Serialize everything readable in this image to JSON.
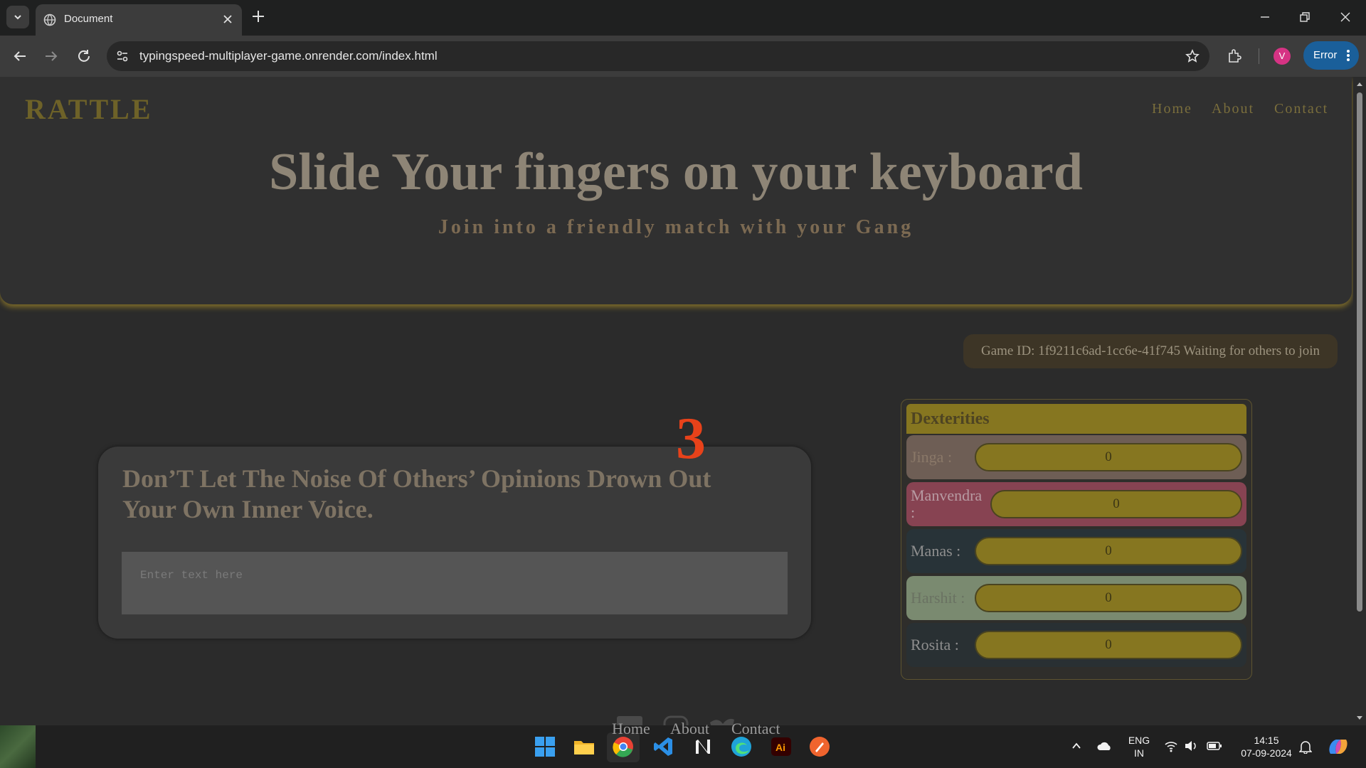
{
  "browser": {
    "tab_title": "Document",
    "url": "typingspeed-multiplayer-game.onrender.com/index.html",
    "profile_initial": "V",
    "error_label": "Error"
  },
  "site": {
    "logo": "RATTLE",
    "nav": [
      "Home",
      "About",
      "Contact"
    ],
    "hero_title": "Slide Your fingers on your keyboard",
    "hero_subtitle": "Join into a friendly match with your Gang"
  },
  "game": {
    "status": "Game ID: 1f9211c6ad-1cc6e-41f745 Waiting for others to join",
    "countdown": "3",
    "quote": "Don’T Let The Noise Of Others’ Opinions Drown Out Your Own Inner Voice.",
    "input_placeholder": "Enter text here"
  },
  "leaderboard": {
    "title": "Dexterities",
    "players": [
      {
        "name": "Jinga :",
        "score": "0",
        "bg": "#6e5e55",
        "name_color": "#8a7868"
      },
      {
        "name": "Manvendra :",
        "score": "0",
        "bg": "#874352",
        "name_color": "#b79aa2"
      },
      {
        "name": "Manas :",
        "score": "0",
        "bg": "#283338",
        "name_color": "#8e8e8e"
      },
      {
        "name": "Harshit :",
        "score": "0",
        "bg": "#7a8a70",
        "name_color": "#6a7262"
      },
      {
        "name": "Rosita :",
        "score": "0",
        "bg": "#293033",
        "name_color": "#8e8e8e"
      }
    ]
  },
  "footer_links": [
    "Home",
    "About",
    "Contact"
  ],
  "taskbar": {
    "lang_top": "ENG",
    "lang_bottom": "IN",
    "time": "14:15",
    "date": "07-09-2024"
  },
  "colors": {
    "accent_gold": "#867620",
    "countdown_red": "#e8421a",
    "chrome_blue": "#1a5f9a"
  }
}
